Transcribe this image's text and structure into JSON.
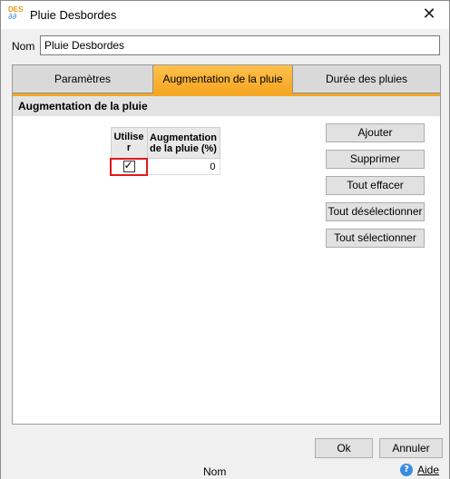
{
  "window": {
    "title": "Pluie Desbordes",
    "icon_text": "DES",
    "icon_drops": "ﾟﾟ"
  },
  "name_field": {
    "label": "Nom",
    "value": "Pluie Desbordes"
  },
  "tabs": [
    {
      "label": "Paramètres",
      "active": false
    },
    {
      "label": "Augmentation de la pluie",
      "active": true
    },
    {
      "label": "Durée des pluies",
      "active": false
    }
  ],
  "section": {
    "title": "Augmentation de la pluie"
  },
  "grid": {
    "headers": [
      "Utilise r",
      "Augmentation de la pluie (%)"
    ],
    "rows": [
      {
        "use": true,
        "value": "0"
      }
    ]
  },
  "actions": {
    "add": "Ajouter",
    "delete": "Supprimer",
    "clear_all": "Tout effacer",
    "deselect_all": "Tout désélectionner",
    "select_all": "Tout sélectionner"
  },
  "footer": {
    "ok": "Ok",
    "cancel": "Annuler"
  },
  "status": {
    "text": "Nom",
    "help": "Aide"
  },
  "colors": {
    "active_tab": "#f5a623",
    "highlight_border": "#e01a1a"
  }
}
